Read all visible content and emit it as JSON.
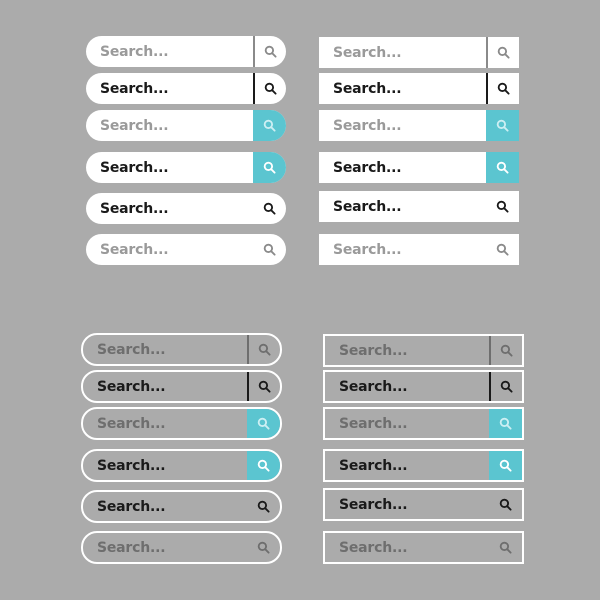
{
  "background_color": "#ababab",
  "accent_color": "#5bc5d0",
  "placeholder_text": "Search...",
  "groups": [
    {
      "name": "white-pill-bars",
      "bars": [
        {
          "label": "Search...",
          "style": "muted, gray divider",
          "icon": "search-icon"
        },
        {
          "label": "Search...",
          "style": "dark, dark divider",
          "icon": "search-icon"
        },
        {
          "label": "Search...",
          "style": "muted, teal button, light icon",
          "icon": "search-icon"
        },
        {
          "label": "Search...",
          "style": "dark, teal button, white icon",
          "icon": "search-icon"
        },
        {
          "label": "Search...",
          "style": "dark, no divider",
          "icon": "search-icon"
        },
        {
          "label": "Search...",
          "style": "muted, no divider",
          "icon": "search-icon"
        }
      ]
    },
    {
      "name": "white-rect-bars",
      "bars": [
        {
          "label": "Search...",
          "style": "muted, gray divider",
          "icon": "search-icon"
        },
        {
          "label": "Search...",
          "style": "dark, dark divider",
          "icon": "search-icon"
        },
        {
          "label": "Search...",
          "style": "muted, teal button, light icon",
          "icon": "search-icon"
        },
        {
          "label": "Search...",
          "style": "dark, teal button, white icon",
          "icon": "search-icon"
        },
        {
          "label": "Search...",
          "style": "dark, no divider",
          "icon": "search-icon"
        },
        {
          "label": "Search...",
          "style": "muted, no divider",
          "icon": "search-icon"
        }
      ]
    },
    {
      "name": "outlined-pill-bars",
      "bars": [
        {
          "label": "Search...",
          "style": "muted, gray divider",
          "icon": "search-icon"
        },
        {
          "label": "Search...",
          "style": "dark, dark divider",
          "icon": "search-icon"
        },
        {
          "label": "Search...",
          "style": "muted, teal button, light icon",
          "icon": "search-icon"
        },
        {
          "label": "Search...",
          "style": "dark, teal button, white icon",
          "icon": "search-icon"
        },
        {
          "label": "Search...",
          "style": "dark, no divider",
          "icon": "search-icon"
        },
        {
          "label": "Search...",
          "style": "muted, no divider",
          "icon": "search-icon"
        }
      ]
    },
    {
      "name": "outlined-rect-bars",
      "bars": [
        {
          "label": "Search...",
          "style": "muted, gray divider",
          "icon": "search-icon"
        },
        {
          "label": "Search...",
          "style": "dark, dark divider",
          "icon": "search-icon"
        },
        {
          "label": "Search...",
          "style": "muted, teal button, light icon",
          "icon": "search-icon"
        },
        {
          "label": "Search...",
          "style": "dark, teal button, white icon",
          "icon": "search-icon"
        },
        {
          "label": "Search...",
          "style": "dark, no divider",
          "icon": "search-icon"
        },
        {
          "label": "Search...",
          "style": "muted, no divider",
          "icon": "search-icon"
        }
      ]
    }
  ]
}
